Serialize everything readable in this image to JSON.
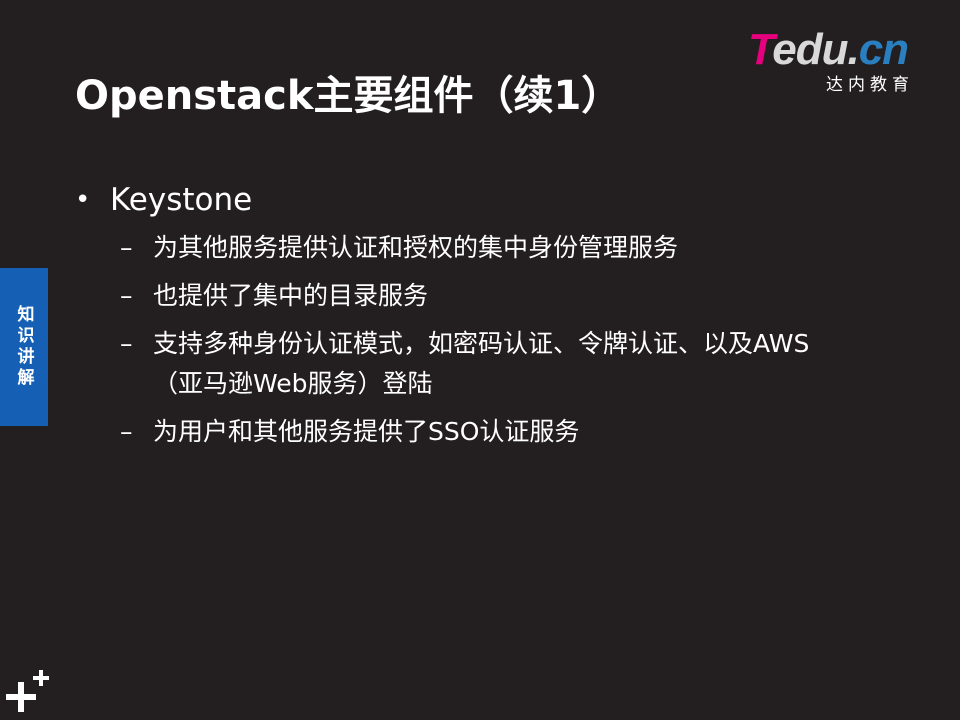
{
  "logo": {
    "t": "T",
    "rest": "edu.",
    "cn": "cn",
    "subtitle": "达内教育"
  },
  "title": "Openstack主要组件（续1）",
  "bullets": [
    {
      "marker": "•",
      "text": "Keystone",
      "sub_marker": "–",
      "subitems": [
        "为其他服务提供认证和授权的集中身份管理服务",
        "也提供了集中的目录服务",
        "支持多种身份认证模式，如密码认证、令牌认证、以及AWS（亚马逊Web服务）登陆",
        "为用户和其他服务提供了SSO认证服务"
      ]
    }
  ],
  "side_tab": {
    "label": "知识讲解"
  },
  "colors": {
    "background": "#231f20",
    "side_tab": "#1560b4",
    "logo_t": "#e6007e",
    "logo_cn": "#2a7fc0"
  },
  "icons": {
    "bottom_left": "plus-plus-icon"
  }
}
